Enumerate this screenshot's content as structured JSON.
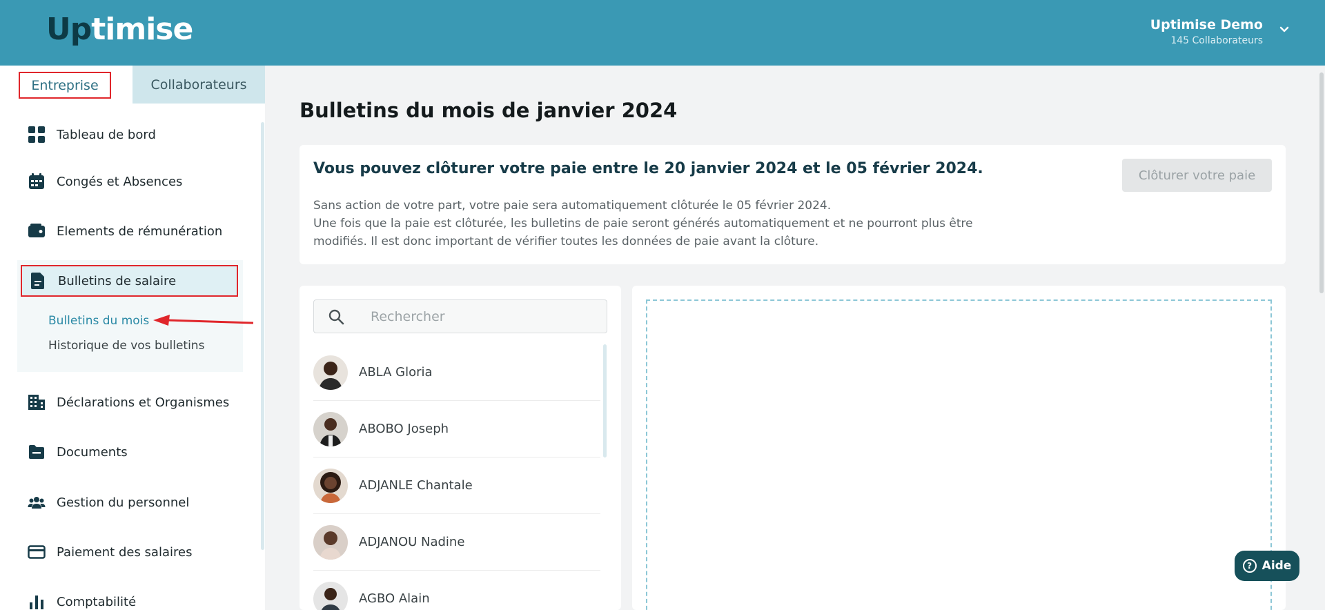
{
  "header": {
    "logo_part1": "Up",
    "logo_part2": "timise",
    "account_name": "Uptimise Demo",
    "account_sub": "145 Collaborateurs"
  },
  "tabs": {
    "entreprise": "Entreprise",
    "collaborateurs": "Collaborateurs"
  },
  "sidebar": {
    "items": [
      {
        "label": "Tableau de bord",
        "icon": "dashboard-icon"
      },
      {
        "label": "Congés et Absences",
        "icon": "calendar-icon"
      },
      {
        "label": "Elements de rémunération",
        "icon": "wallet-icon"
      },
      {
        "label": "Bulletins de salaire",
        "icon": "document-icon"
      },
      {
        "label": "Déclarations et Organismes",
        "icon": "building-icon"
      },
      {
        "label": "Documents",
        "icon": "folder-icon"
      },
      {
        "label": "Gestion du personnel",
        "icon": "people-icon"
      },
      {
        "label": "Paiement des salaires",
        "icon": "credit-card-icon"
      },
      {
        "label": "Comptabilité",
        "icon": "bar-chart-icon"
      }
    ],
    "subitems": [
      {
        "label": "Bulletins du mois"
      },
      {
        "label": "Historique de vos bulletins"
      }
    ]
  },
  "main": {
    "title": "Bulletins du mois de janvier 2024",
    "info_title": "Vous pouvez clôturer votre paie entre le 20 janvier 2024 et le 05 février 2024.",
    "info_line1": "Sans action de votre part, votre paie sera automatiquement clôturée le 05 février 2024.",
    "info_line2": "Une fois que la paie est clôturée, les bulletins de paie seront générés automatiquement et ne pourront plus être",
    "info_line3": "modifiés. Il est donc important de vérifier toutes les données de paie avant la clôture.",
    "close_button": "Clôturer votre paie",
    "search_placeholder": "Rechercher",
    "employees": [
      {
        "name": "ABLA Gloria"
      },
      {
        "name": "ABOBO Joseph"
      },
      {
        "name": "ADJANLE Chantale"
      },
      {
        "name": "ADJANOU Nadine"
      },
      {
        "name": "AGBO Alain"
      }
    ]
  },
  "help_button": "Aide",
  "colors": {
    "header": "#3a99b4",
    "accent": "#2c8aa6",
    "highlight_border": "#e0262b",
    "help": "#16505a"
  }
}
